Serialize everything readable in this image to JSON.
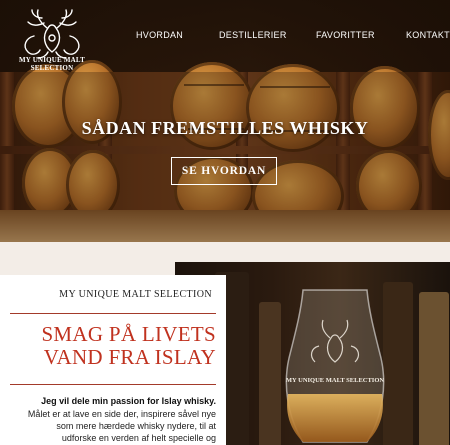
{
  "brand": {
    "logo_text": "MY UNIQUE MALT SELECTION"
  },
  "nav": {
    "items": [
      "HVORDAN",
      "DESTILLERIER",
      "FAVORITTER",
      "KONTAKT"
    ]
  },
  "hero": {
    "title": "SÅDAN FREMSTILLES WHISKY",
    "button": "SE HVORDAN"
  },
  "intro": {
    "kicker": "MY UNIQUE MALT SELECTION",
    "title_line1": "SMAG PÅ LIVETS",
    "title_line2": "VAND FRA ISLAY",
    "lead": "Jeg vil dele min passion for Islay whisky.",
    "body_line1": "Målet er at lave en side der, inspirere såvel nye",
    "body_line2": "som mere hærdede whisky nydere, til at",
    "body_line3": "udforske en verden af helt specielle og"
  },
  "glass_etching": {
    "text": "MY UNIQUE MALT SELECTION"
  },
  "colors": {
    "accent": "#c0321f",
    "dark_wood": "#3a1e0c"
  }
}
